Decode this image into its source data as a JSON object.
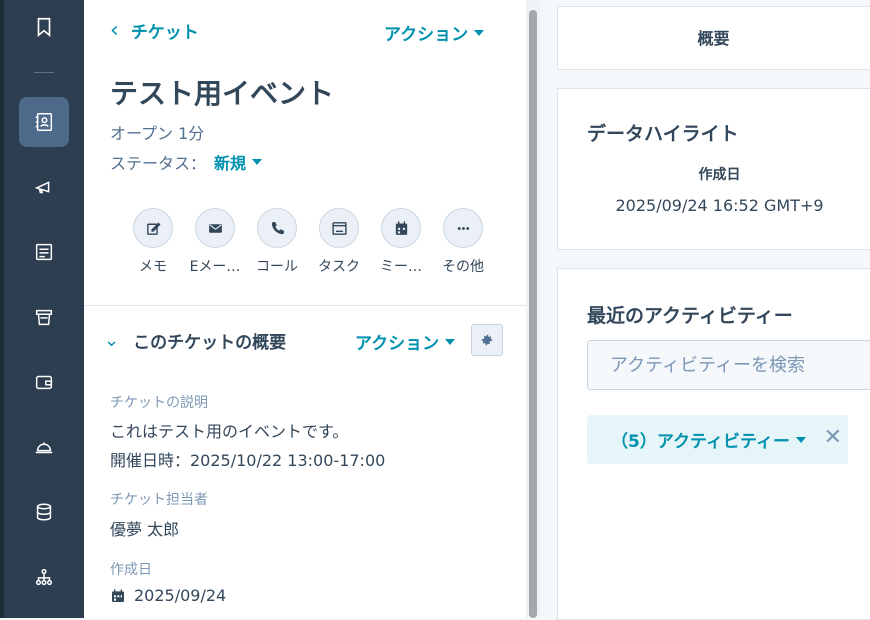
{
  "sidebar": {
    "icons": [
      "bookmark-icon",
      "contacts-icon",
      "marketing-icon",
      "reports-icon",
      "commerce-icon",
      "wallet-icon",
      "service-icon",
      "database-icon",
      "org-chart-icon"
    ],
    "active": "contacts-icon",
    "colors": {
      "bg": "#2d3e50",
      "active_bg": "#4d6a8a"
    }
  },
  "header": {
    "back_label": "チケット",
    "actions_label": "アクション"
  },
  "record": {
    "title": "テスト用イベント",
    "open_time": "オープン 1分",
    "status_label": "ステータス：",
    "status_value": "新規"
  },
  "quick_actions": [
    {
      "label": "メモ",
      "icon": "edit-icon"
    },
    {
      "label": "Eメー…",
      "icon": "email-icon"
    },
    {
      "label": "コール",
      "icon": "phone-icon"
    },
    {
      "label": "タスク",
      "icon": "task-icon"
    },
    {
      "label": "ミー…",
      "icon": "calendar-icon"
    },
    {
      "label": "その他",
      "icon": "more-icon"
    }
  ],
  "about": {
    "title": "このチケットの概要",
    "actions_label": "アクション",
    "description_label": "チケットの説明",
    "description_line1": "これはテスト用のイベントです。",
    "description_line2": "開催日時：2025/10/22 13:00-17:00",
    "owner_label": "チケット担当者",
    "owner_value": "優夢 太郎",
    "created_label": "作成日",
    "created_value": "2025/09/24"
  },
  "right": {
    "tab_label": "概要",
    "highlights_title": "データハイライト",
    "created_label": "作成日",
    "created_value": "2025/09/24 16:52 GMT+9",
    "activity_title": "最近のアクティビティー",
    "search_placeholder": "アクティビティーを検索",
    "filter_label": "（5）アクティビティー"
  },
  "colors": {
    "accent": "#0091ae",
    "text": "#33475b",
    "muted": "#516f90"
  }
}
